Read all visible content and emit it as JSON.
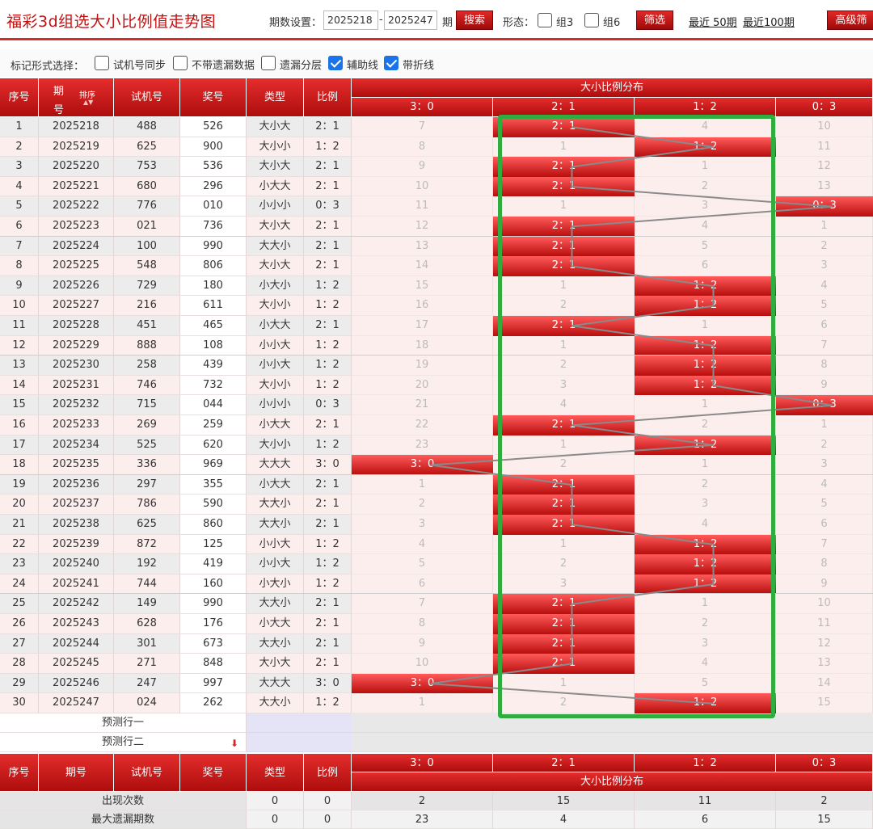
{
  "header": {
    "title": "福彩3d组选大小比例值走势图",
    "period_label": "期数设置：",
    "period_from": "2025218",
    "period_to": "2025247",
    "period_dash": "-",
    "period_unit": "期",
    "search_label": "搜索",
    "shape_label": "形态：",
    "group3_label": "组3",
    "group6_label": "组6",
    "filter_label": "筛选",
    "recent50_label": "最近 50期",
    "recent100_label": "最近100期",
    "advanced_label": "高级筛"
  },
  "options": {
    "label": "标记形式选择：",
    "items": [
      {
        "label": "试机号同步",
        "checked": false
      },
      {
        "label": "不带遗漏数据",
        "checked": false
      },
      {
        "label": "遗漏分层",
        "checked": false
      },
      {
        "label": "辅助线",
        "checked": true
      },
      {
        "label": "带折线",
        "checked": true
      }
    ]
  },
  "table": {
    "headers": {
      "seq": "序号",
      "period_a": "期",
      "period_b": "号",
      "sort": "排序",
      "trial": "试机号",
      "draw": "奖号",
      "type": "类型",
      "ratio": "比例",
      "dist_title": "大小比例分布"
    },
    "dist_columns": [
      "3：0",
      "2：1",
      "1：2",
      "0：3"
    ],
    "rows": [
      {
        "seq": "1",
        "period": "2025218",
        "trial": "488",
        "draw": "526",
        "type": "大小大",
        "ratio": "2：1",
        "cells": [
          "7",
          "2：1",
          "4",
          "10"
        ],
        "hit": 1
      },
      {
        "seq": "2",
        "period": "2025219",
        "trial": "625",
        "draw": "900",
        "type": "大小小",
        "ratio": "1：2",
        "cells": [
          "8",
          "1",
          "1：2",
          "11"
        ],
        "hit": 2
      },
      {
        "seq": "3",
        "period": "2025220",
        "trial": "753",
        "draw": "536",
        "type": "大小大",
        "ratio": "2：1",
        "cells": [
          "9",
          "2：1",
          "1",
          "12"
        ],
        "hit": 1
      },
      {
        "seq": "4",
        "period": "2025221",
        "trial": "680",
        "draw": "296",
        "type": "小大大",
        "ratio": "2：1",
        "cells": [
          "10",
          "2：1",
          "2",
          "13"
        ],
        "hit": 1
      },
      {
        "seq": "5",
        "period": "2025222",
        "trial": "776",
        "draw": "010",
        "type": "小小小",
        "ratio": "0：3",
        "cells": [
          "11",
          "1",
          "3",
          "0：3"
        ],
        "hit": 3
      },
      {
        "seq": "6",
        "period": "2025223",
        "trial": "021",
        "draw": "736",
        "type": "大小大",
        "ratio": "2：1",
        "cells": [
          "12",
          "2：1",
          "4",
          "1"
        ],
        "hit": 1
      },
      {
        "seq": "7",
        "period": "2025224",
        "trial": "100",
        "draw": "990",
        "type": "大大小",
        "ratio": "2：1",
        "cells": [
          "13",
          "2：1",
          "5",
          "2"
        ],
        "hit": 1
      },
      {
        "seq": "8",
        "period": "2025225",
        "trial": "548",
        "draw": "806",
        "type": "大小大",
        "ratio": "2：1",
        "cells": [
          "14",
          "2：1",
          "6",
          "3"
        ],
        "hit": 1
      },
      {
        "seq": "9",
        "period": "2025226",
        "trial": "729",
        "draw": "180",
        "type": "小大小",
        "ratio": "1：2",
        "cells": [
          "15",
          "1",
          "1：2",
          "4"
        ],
        "hit": 2
      },
      {
        "seq": "10",
        "period": "2025227",
        "trial": "216",
        "draw": "611",
        "type": "大小小",
        "ratio": "1：2",
        "cells": [
          "16",
          "2",
          "1：2",
          "5"
        ],
        "hit": 2
      },
      {
        "seq": "11",
        "period": "2025228",
        "trial": "451",
        "draw": "465",
        "type": "小大大",
        "ratio": "2：1",
        "cells": [
          "17",
          "2：1",
          "1",
          "6"
        ],
        "hit": 1
      },
      {
        "seq": "12",
        "period": "2025229",
        "trial": "888",
        "draw": "108",
        "type": "小小大",
        "ratio": "1：2",
        "cells": [
          "18",
          "1",
          "1：2",
          "7"
        ],
        "hit": 2
      },
      {
        "seq": "13",
        "period": "2025230",
        "trial": "258",
        "draw": "439",
        "type": "小小大",
        "ratio": "1：2",
        "cells": [
          "19",
          "2",
          "1：2",
          "8"
        ],
        "hit": 2
      },
      {
        "seq": "14",
        "period": "2025231",
        "trial": "746",
        "draw": "732",
        "type": "大小小",
        "ratio": "1：2",
        "cells": [
          "20",
          "3",
          "1：2",
          "9"
        ],
        "hit": 2
      },
      {
        "seq": "15",
        "period": "2025232",
        "trial": "715",
        "draw": "044",
        "type": "小小小",
        "ratio": "0：3",
        "cells": [
          "21",
          "4",
          "1",
          "0：3"
        ],
        "hit": 3
      },
      {
        "seq": "16",
        "period": "2025233",
        "trial": "269",
        "draw": "259",
        "type": "小大大",
        "ratio": "2：1",
        "cells": [
          "22",
          "2：1",
          "2",
          "1"
        ],
        "hit": 1
      },
      {
        "seq": "17",
        "period": "2025234",
        "trial": "525",
        "draw": "620",
        "type": "大小小",
        "ratio": "1：2",
        "cells": [
          "23",
          "1",
          "1：2",
          "2"
        ],
        "hit": 2
      },
      {
        "seq": "18",
        "period": "2025235",
        "trial": "336",
        "draw": "969",
        "type": "大大大",
        "ratio": "3：0",
        "cells": [
          "3：0",
          "2",
          "1",
          "3"
        ],
        "hit": 0
      },
      {
        "seq": "19",
        "period": "2025236",
        "trial": "297",
        "draw": "355",
        "type": "小大大",
        "ratio": "2：1",
        "cells": [
          "1",
          "2：1",
          "2",
          "4"
        ],
        "hit": 1
      },
      {
        "seq": "20",
        "period": "2025237",
        "trial": "786",
        "draw": "590",
        "type": "大大小",
        "ratio": "2：1",
        "cells": [
          "2",
          "2：1",
          "3",
          "5"
        ],
        "hit": 1
      },
      {
        "seq": "21",
        "period": "2025238",
        "trial": "625",
        "draw": "860",
        "type": "大大小",
        "ratio": "2：1",
        "cells": [
          "3",
          "2：1",
          "4",
          "6"
        ],
        "hit": 1
      },
      {
        "seq": "22",
        "period": "2025239",
        "trial": "872",
        "draw": "125",
        "type": "小小大",
        "ratio": "1：2",
        "cells": [
          "4",
          "1",
          "1：2",
          "7"
        ],
        "hit": 2
      },
      {
        "seq": "23",
        "period": "2025240",
        "trial": "192",
        "draw": "419",
        "type": "小小大",
        "ratio": "1：2",
        "cells": [
          "5",
          "2",
          "1：2",
          "8"
        ],
        "hit": 2
      },
      {
        "seq": "24",
        "period": "2025241",
        "trial": "744",
        "draw": "160",
        "type": "小大小",
        "ratio": "1：2",
        "cells": [
          "6",
          "3",
          "1：2",
          "9"
        ],
        "hit": 2
      },
      {
        "seq": "25",
        "period": "2025242",
        "trial": "149",
        "draw": "990",
        "type": "大大小",
        "ratio": "2：1",
        "cells": [
          "7",
          "2：1",
          "1",
          "10"
        ],
        "hit": 1
      },
      {
        "seq": "26",
        "period": "2025243",
        "trial": "628",
        "draw": "176",
        "type": "小大大",
        "ratio": "2：1",
        "cells": [
          "8",
          "2：1",
          "2",
          "11"
        ],
        "hit": 1
      },
      {
        "seq": "27",
        "period": "2025244",
        "trial": "301",
        "draw": "673",
        "type": "大大小",
        "ratio": "2：1",
        "cells": [
          "9",
          "2：1",
          "3",
          "12"
        ],
        "hit": 1
      },
      {
        "seq": "28",
        "period": "2025245",
        "trial": "271",
        "draw": "848",
        "type": "大小大",
        "ratio": "2：1",
        "cells": [
          "10",
          "2：1",
          "4",
          "13"
        ],
        "hit": 1
      },
      {
        "seq": "29",
        "period": "2025246",
        "trial": "247",
        "draw": "997",
        "type": "大大大",
        "ratio": "3：0",
        "cells": [
          "3：0",
          "1",
          "5",
          "14"
        ],
        "hit": 0
      },
      {
        "seq": "30",
        "period": "2025247",
        "trial": "024",
        "draw": "262",
        "type": "大大小",
        "ratio": "1：2",
        "cells": [
          "1",
          "2",
          "1：2",
          "15"
        ],
        "hit": 2
      }
    ],
    "predict": [
      "预测行一",
      "预测行二"
    ],
    "footer_headers": {
      "seq": "序号",
      "period": "期号",
      "trial": "试机号",
      "draw": "奖号",
      "type": "类型",
      "ratio": "比例",
      "dist_title": "大小比例分布"
    },
    "stats": [
      {
        "label": "出现次数",
        "values": [
          "0",
          "0",
          "2",
          "15",
          "11",
          "2"
        ]
      },
      {
        "label": "最大遗漏期数",
        "values": [
          "0",
          "0",
          "23",
          "4",
          "6",
          "15"
        ]
      }
    ]
  },
  "colors": {
    "brand_red": "#c40f0f",
    "highlight_green": "#2fae3f",
    "check_blue": "#1a73e8"
  }
}
